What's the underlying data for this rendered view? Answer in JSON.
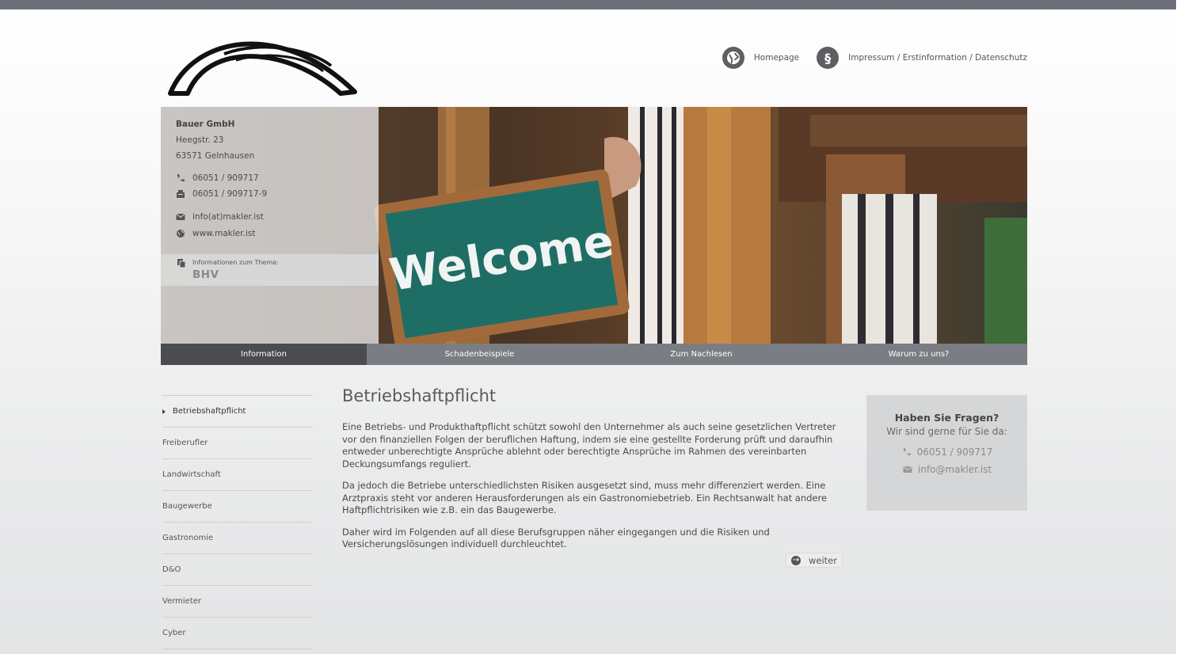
{
  "header": {
    "links": [
      {
        "label": "Homepage",
        "icon": "globe-icon"
      },
      {
        "label": "Impressum / Erstinformation / Datenschutz",
        "icon": "paragraph-icon",
        "symbol": "§"
      }
    ]
  },
  "hero": {
    "sign_text": "Welcome",
    "contact": {
      "company": "Bauer GmbH",
      "street": "Heegstr. 23",
      "city": "63571 Gelnhausen",
      "phone": "06051 / 909717",
      "fax": "06051 / 909717-9",
      "email": "info(at)makler.ist",
      "web": "www.makler.ist",
      "topic_label": "Informationen zum Thema:",
      "topic": "BHV"
    }
  },
  "nav": {
    "items": [
      {
        "label": "Information",
        "active": true
      },
      {
        "label": "Schadenbeispiele",
        "active": false
      },
      {
        "label": "Zum Nachlesen",
        "active": false
      },
      {
        "label": "Warum zu uns?",
        "active": false
      }
    ]
  },
  "sidebar": {
    "items": [
      {
        "label": "Betriebshaftpflicht",
        "active": true
      },
      {
        "label": "Freiberufler",
        "active": false
      },
      {
        "label": "Landwirtschaft",
        "active": false
      },
      {
        "label": "Baugewerbe",
        "active": false
      },
      {
        "label": "Gastronomie",
        "active": false
      },
      {
        "label": "D&O",
        "active": false
      },
      {
        "label": "Vermieter",
        "active": false
      },
      {
        "label": "Cyber",
        "active": false
      }
    ]
  },
  "main": {
    "title": "Betriebshaftpflicht",
    "paragraphs": [
      "Eine Betriebs- und Produkthaftpflicht schützt sowohl den Unternehmer als auch seine gesetzlichen Vertreter vor den finanziellen Folgen der beruflichen Haftung, indem sie eine gestellte Forderung prüft und daraufhin entweder unberechtigte Ansprüche ablehnt oder berechtigte Ansprüche im Rahmen des vereinbarten Deckungsumfangs reguliert.",
      "Da jedoch die Betriebe unterschiedlichsten Risiken ausgesetzt sind, muss mehr differenziert werden. Eine Arztpraxis steht vor anderen Herausforderungen als ein Gastronomiebetrieb. Ein Rechtsanwalt hat andere Haftpflichtrisiken wie z.B. ein das Baugewerbe.",
      "Daher wird im Folgenden auf all diese Berufsgruppen näher eingegangen und die Risiken und Versicherungslösungen individuell durchleuchtet."
    ],
    "more_label": "weiter"
  },
  "faq": {
    "title": "Haben Sie Fragen?",
    "subtitle": "Wir sind gerne für Sie da:",
    "phone": "06051 / 909717",
    "email": "info@makler.ist"
  },
  "colors": {
    "nav_bg": "#7b7d84",
    "nav_active": "#4b4c52",
    "topbar": "#6e7079"
  }
}
